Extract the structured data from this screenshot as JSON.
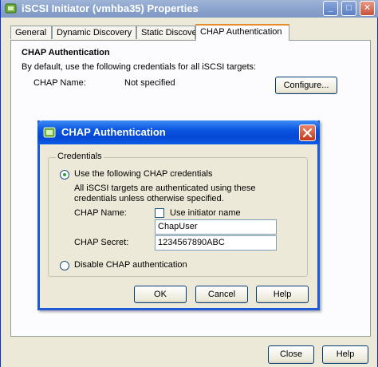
{
  "window": {
    "title": "iSCSI Initiator (vmhba35) Properties",
    "controls": {
      "minimize": "_",
      "maximize": "□",
      "close": "✕"
    }
  },
  "tabs": [
    {
      "label": "General",
      "active": false
    },
    {
      "label": "Dynamic Discovery",
      "active": false
    },
    {
      "label": "Static Discovery",
      "active": false
    },
    {
      "label": "CHAP Authentication",
      "active": true
    }
  ],
  "panel": {
    "heading": "CHAP Authentication",
    "description": "By default, use the following credentials for all iSCSI targets:",
    "chap_name_label": "CHAP Name:",
    "chap_name_value": "Not specified",
    "configure_button": "Configure..."
  },
  "dialog": {
    "title": "CHAP Authentication",
    "close_icon": "close-icon",
    "credentials_legend": "Credentials",
    "use_chap_label": "Use the following CHAP credentials",
    "use_chap_selected": true,
    "info_line1": "All iSCSI targets are authenticated using these",
    "info_line2": "credentials unless otherwise specified.",
    "chap_name_label": "CHAP Name:",
    "use_initiator_name_label": "Use initiator name",
    "use_initiator_name_checked": false,
    "chap_name_value": "ChapUser",
    "chap_secret_label": "CHAP Secret:",
    "chap_secret_value": "1234567890ABC",
    "disable_chap_label": "Disable CHAP authentication",
    "disable_chap_selected": false,
    "buttons": {
      "ok": "OK",
      "cancel": "Cancel",
      "help": "Help"
    }
  },
  "footer": {
    "close": "Close",
    "help": "Help"
  },
  "colors": {
    "xp_blue": "#0a55e0",
    "tab_accent": "#e68b2c",
    "face": "#ece9d8"
  }
}
